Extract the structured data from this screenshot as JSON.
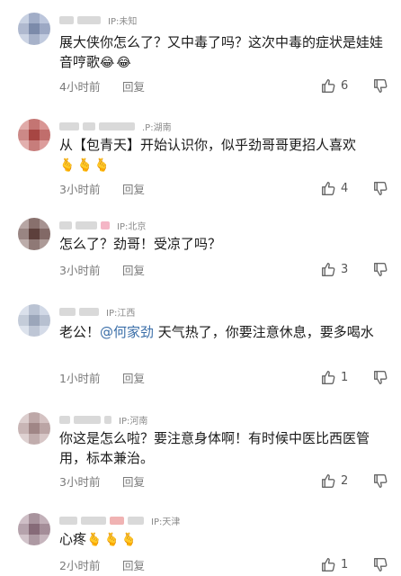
{
  "comments": [
    {
      "ip": "IP:未知",
      "text": "展大侠你怎么了？又中毒了吗？这次中毒的症状是娃娃音哼歌",
      "emojis": [
        "😂",
        "😂"
      ],
      "time": "4小时前",
      "reply": "回复",
      "likes": "6",
      "avatar_color": "#8fa0c4"
    },
    {
      "ip": ".P:湖南",
      "text": "从【包青天】开始认识你，似乎劲哥哥更招人喜欢",
      "emojis": [
        "🫰",
        "🫰",
        "🫰"
      ],
      "time": "3小时前",
      "reply": "回复",
      "likes": "4",
      "avatar_color": "#c0504d"
    },
    {
      "ip": "IP:北京",
      "text": "怎么了？劲哥！受凉了吗？",
      "emojis": [],
      "time": "3小时前",
      "reply": "回复",
      "likes": "3",
      "avatar_color": "#6b4a45"
    },
    {
      "ip": "IP:江西",
      "text_before": "老公！",
      "mention": "@何家劲",
      "text_after": " 天气热了，你要注意休息，要多喝水",
      "time": "1小时前",
      "reply": "回复",
      "likes": "1",
      "avatar_color": "#b3bfd6"
    },
    {
      "ip": "IP:河南",
      "text": "你这是怎么啦？要注意身体啊！有时候中医比西医管用，标本兼治。",
      "emojis": [],
      "time": "3小时前",
      "reply": "回复",
      "likes": "2",
      "avatar_color": "#b89a9a"
    },
    {
      "ip": "IP:天津",
      "text": "心疼",
      "emojis": [
        "🫰",
        "🫰",
        "🫰"
      ],
      "time": "2小时前",
      "reply": "回复",
      "likes": "1",
      "avatar_color": "#9a7b8a"
    }
  ],
  "icons": {
    "like": "thumbs-up-icon",
    "dislike": "thumbs-down-icon"
  }
}
